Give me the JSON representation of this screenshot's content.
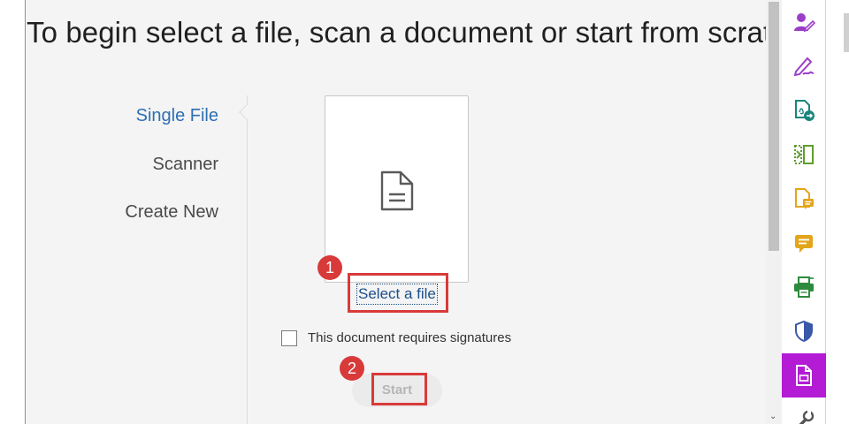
{
  "heading": "To begin select a file, scan a document or start from scratc",
  "source_nav": {
    "items": [
      {
        "label": "Single File",
        "active": true
      },
      {
        "label": "Scanner",
        "active": false
      },
      {
        "label": "Create New",
        "active": false
      }
    ]
  },
  "drop_card": {
    "icon": "document-icon"
  },
  "select_link": "Select a file",
  "signature_option": {
    "label": "This document requires signatures",
    "checked": false
  },
  "start_button": {
    "label": "Start",
    "enabled": false
  },
  "callouts": [
    {
      "step": "1",
      "target": "select-file-link"
    },
    {
      "step": "2",
      "target": "start-button"
    }
  ],
  "tools_panel": {
    "tools": [
      {
        "icon": "request-signatures-icon",
        "color": "#9b3fc7"
      },
      {
        "icon": "fill-sign-icon",
        "color": "#9b3fc7"
      },
      {
        "icon": "export-pdf-icon",
        "color": "#17857c"
      },
      {
        "icon": "organize-pages-icon",
        "color": "#5e9e2e"
      },
      {
        "icon": "comment-file-icon",
        "color": "#e3a51a"
      },
      {
        "icon": "comment-icon",
        "color": "#e3a51a"
      },
      {
        "icon": "print-production-icon",
        "color": "#2e8b3e"
      },
      {
        "icon": "protect-icon",
        "color": "#3a58a8"
      },
      {
        "icon": "prepare-form-icon",
        "color": "#ffffff",
        "active": true,
        "background": "#b31bd4"
      },
      {
        "icon": "more-tools-icon",
        "color": "#555555"
      }
    ]
  },
  "colors": {
    "accent_link": "#2d6fb4",
    "callout_red": "#d83a3a",
    "active_tool_bg": "#b31bd4"
  }
}
